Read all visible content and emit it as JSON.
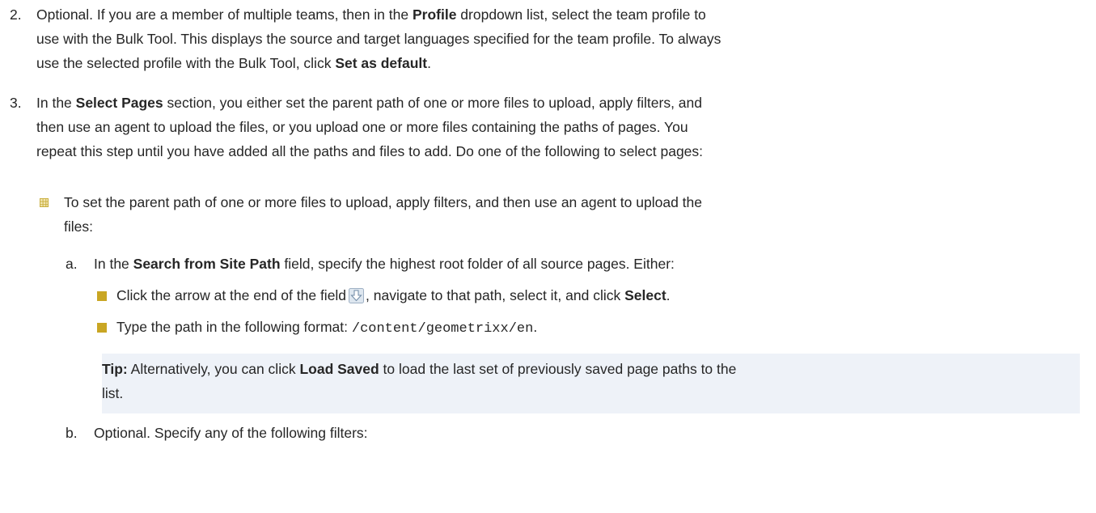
{
  "step2": {
    "number": "2.",
    "line1_a": "Optional. If you are a member of multiple teams, then in the ",
    "line1_b": "Profile",
    "line1_c": " dropdown list, select the team profile to",
    "line2": "use with the Bulk Tool. This displays the source and target languages specified for the team profile. To always",
    "line3_a": "use the selected profile with the Bulk Tool, click ",
    "line3_b": "Set as default",
    "line3_c": "."
  },
  "step3": {
    "number": "3.",
    "line1_a": "In the ",
    "line1_b": "Select Pages",
    "line1_c": " section, you either set the parent path of one or more files to upload, apply filters, and",
    "line2": "then use an agent to upload the files, or you upload one or more files containing the paths of pages. You",
    "line3": "repeat this step until you have added all the paths and files to add. Do one of the following to select pages:"
  },
  "option1": {
    "line1": "To set the parent path of one or more files to upload, apply filters, and then use an agent to upload the",
    "line2": "files:"
  },
  "substep_a": {
    "letter": "a.",
    "text_a": "In the ",
    "text_b": "Search from Site Path",
    "text_c": " field, specify the highest root folder of all source pages. Either:"
  },
  "bullet1": {
    "text_a": "Click the arrow at the end of the field",
    "icon": "down-arrow-icon",
    "text_b": ", navigate to that path, select it, and click ",
    "text_c": "Select",
    "text_d": "."
  },
  "bullet2": {
    "text_a": "Type the path in the following format: ",
    "code": "/content/geometrixx/en",
    "text_b": "."
  },
  "tip": {
    "label": "Tip:",
    "text_a": " Alternatively, you can click ",
    "text_b": "Load Saved",
    "text_c": " to load the last set of previously saved page paths to the",
    "line2": "list."
  },
  "substep_b": {
    "letter": "b.",
    "text": "Optional. Specify any of the following filters:"
  },
  "colors": {
    "text": "#262626",
    "bullet": "#c9a623",
    "tip_background": "#eef2f8"
  }
}
